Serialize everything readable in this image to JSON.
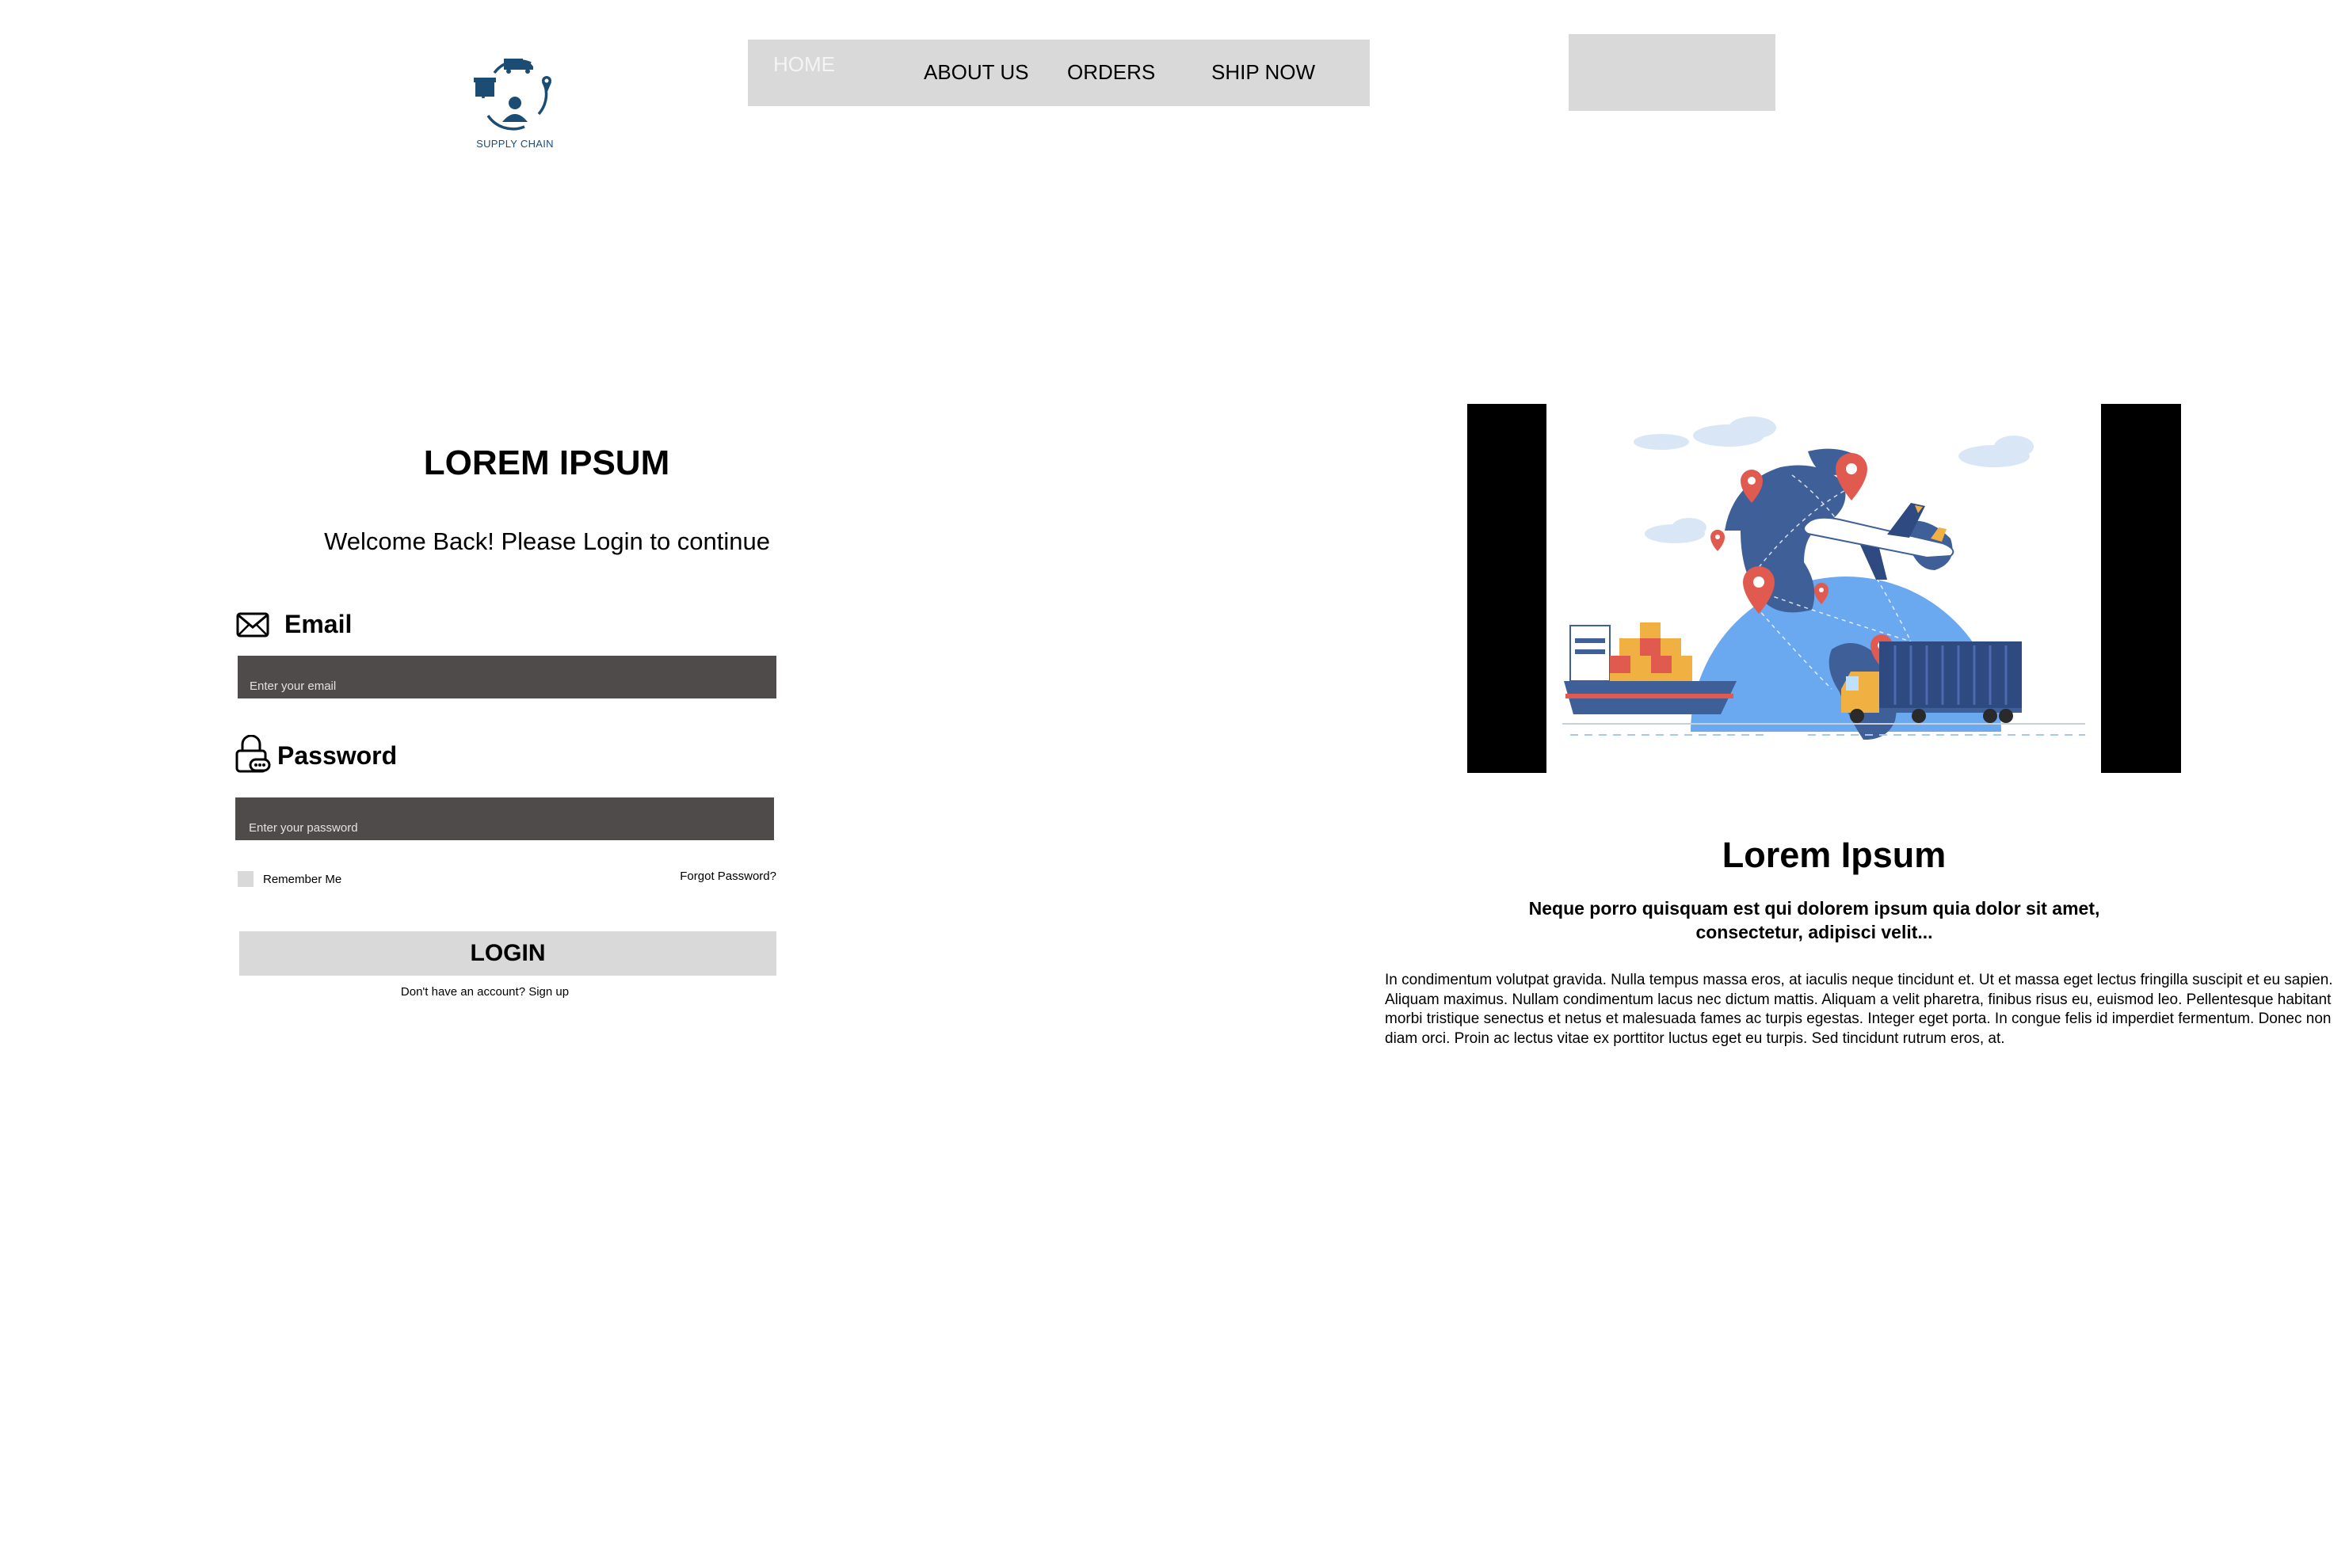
{
  "header": {
    "logo_text": "SUPPLY CHAIN",
    "nav": {
      "home": "HOME",
      "about": "ABOUT US",
      "orders": "ORDERS",
      "ship_now": "SHIP NOW"
    }
  },
  "login": {
    "title": "LOREM IPSUM",
    "subtitle": "Welcome Back! Please Login to continue",
    "email_label": "Email",
    "email_placeholder": "Enter your email",
    "password_label": "Password",
    "password_placeholder": "Enter your password",
    "remember_me": "Remember Me",
    "forgot_password": "Forgot Password?",
    "login_button": "LOGIN",
    "signup_prompt": "Don't have an account?",
    "signup_link": "Sign up"
  },
  "info": {
    "title": "Lorem Ipsum",
    "subtitle": "Neque porro quisquam est qui dolorem ipsum quia dolor sit amet, consectetur, adipisci velit...",
    "body": "In condimentum volutpat gravida. Nulla tempus massa eros, at iaculis neque tincidunt et. Ut et massa eget lectus fringilla suscipit et eu sapien. Aliquam maximus. Nullam condimentum lacus nec dictum mattis. Aliquam a velit pharetra, finibus risus eu, euismod leo. Pellentesque habitant morbi tristique senectus et netus et malesuada fames ac turpis egestas. Integer eget porta. In congue felis id imperdiet fermentum. Donec non diam orci. Proin ac lectus vitae ex porttitor luctus eget eu turpis. Sed tincidunt rutrum eros, at."
  },
  "icons": {
    "logo": "supply-chain-logo",
    "email": "envelope-icon",
    "password": "lock-icon",
    "hero": "logistics-globe-illustration"
  },
  "colors": {
    "nav_bg": "#d9d9d9",
    "input_bg": "#504b4b",
    "logo_blue": "#1b4c74",
    "globe_blue": "#6aa8f0",
    "map_dark": "#3f5f99",
    "pin_red": "#e15a50"
  }
}
